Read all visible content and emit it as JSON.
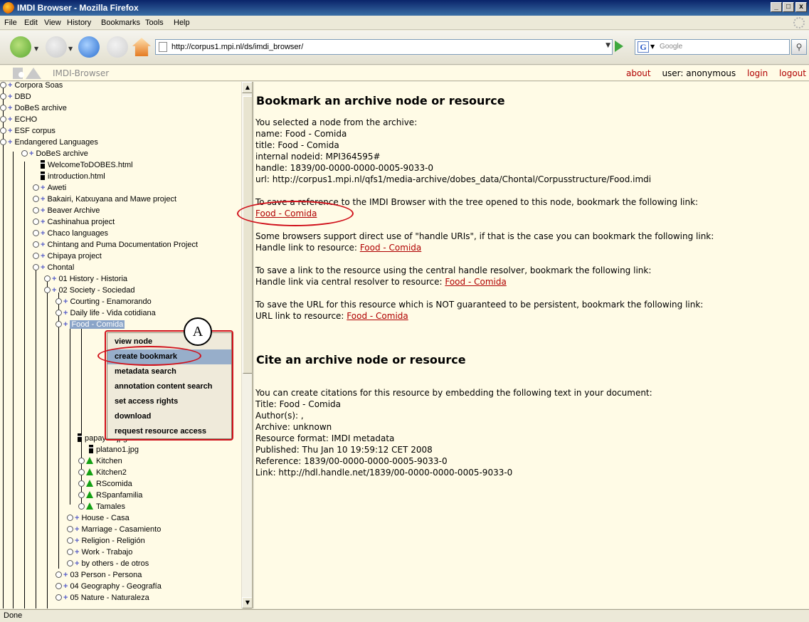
{
  "window": {
    "title": "IMDI Browser - Mozilla Firefox",
    "minimize": "_",
    "maximize": "□",
    "close": "x"
  },
  "menubar": [
    "File",
    "Edit",
    "View",
    "History",
    "Bookmarks",
    "Tools",
    "Help"
  ],
  "navbar": {
    "url": "http://corpus1.mpi.nl/ds/imdi_browser/",
    "search_placeholder": "Google",
    "search_engine_icon": "G"
  },
  "app": {
    "title": "IMDI-Browser",
    "links": {
      "about": "about",
      "user": "user: anonymous",
      "login": "login",
      "logout": "logout"
    }
  },
  "tree": [
    {
      "label": "Corpora Soas"
    },
    {
      "label": "DBD"
    },
    {
      "label": "DoBeS archive"
    },
    {
      "label": "ECHO"
    },
    {
      "label": "ESF corpus"
    },
    {
      "label": "Endangered Languages"
    },
    {
      "label": "DoBeS archive"
    },
    {
      "label": "WelcomeToDOBES.html"
    },
    {
      "label": "introduction.html"
    },
    {
      "label": "Aweti"
    },
    {
      "label": "Bakairi, Katxuyana and Mawe project"
    },
    {
      "label": "Beaver Archive"
    },
    {
      "label": "Cashinahua project"
    },
    {
      "label": "Chaco languages"
    },
    {
      "label": "Chintang and Puma Documentation Project"
    },
    {
      "label": "Chipaya project"
    },
    {
      "label": "Chontal"
    },
    {
      "label": "01 History - Historia"
    },
    {
      "label": "02 Society - Sociedad"
    },
    {
      "label": "Courting - Enamorando"
    },
    {
      "label": "Daily life - Vida cotidiana"
    },
    {
      "label": "Food - Comida"
    },
    {
      "label": "papaya2.jpg"
    },
    {
      "label": "platano1.jpg"
    },
    {
      "label": "Kitchen"
    },
    {
      "label": "Kitchen2"
    },
    {
      "label": "RScomida"
    },
    {
      "label": "RSpanfamilia"
    },
    {
      "label": "Tamales"
    },
    {
      "label": "House - Casa"
    },
    {
      "label": "Marriage - Casamiento"
    },
    {
      "label": "Religion - Religión"
    },
    {
      "label": "Work - Trabajo"
    },
    {
      "label": "by others - de otros"
    },
    {
      "label": "03 Person - Persona"
    },
    {
      "label": "04 Geography - Geografía"
    },
    {
      "label": "05 Nature - Naturaleza"
    }
  ],
  "context_menu": {
    "items": [
      "view node",
      "create bookmark",
      "metadata search",
      "annotation content search",
      "set access rights",
      "download",
      "request resource access"
    ],
    "highlighted": "create bookmark"
  },
  "callout": "A",
  "bookmark": {
    "heading": "Bookmark an archive node or resource",
    "intro": "You selected a node from the archive:",
    "name": "name: Food - Comida",
    "title": "title: Food - Comida",
    "nodeid": "internal nodeid: MPI364595#",
    "handle": "handle: 1839/00-0000-0000-0005-9033-0",
    "url": "url: http://corpus1.mpi.nl/qfs1/media-archive/dobes_data/Chontal/Corpusstructure/Food.imdi",
    "save_text": "To save a reference to the IMDI Browser with the tree opened to this node, bookmark the following link:",
    "save_link": "Food - Comida",
    "handle_uri_text": "Some browsers support direct use of \"handle URIs\", if that is the case you can bookmark the following link:",
    "handle_uri_prefix": "Handle link to resource:",
    "handle_uri_link": "Food - Comida",
    "resolver_text": "To save a link to the resource using the central handle resolver, bookmark the following link:",
    "resolver_prefix": "Handle link via central resolver to resource:",
    "resolver_link": "Food - Comida",
    "url_text": "To save the URL for this resource which is NOT guaranteed to be persistent, bookmark the following link:",
    "url_prefix": "URL link to resource:",
    "url_link": "Food - Comida"
  },
  "cite": {
    "heading": "Cite an archive node or resource",
    "intro": "You can create citations for this resource by embedding the following text in your document:",
    "title": "Title: Food - Comida",
    "authors": "Author(s): ,",
    "archive": "Archive: unknown",
    "format": "Resource format: IMDI metadata",
    "published": "Published: Thu Jan 10 19:59:12 CET 2008",
    "reference": "Reference: 1839/00-0000-0000-0005-9033-0",
    "link": "Link: http://hdl.handle.net/1839/00-0000-0000-0005-9033-0"
  },
  "status": "Done",
  "colors": {
    "link": "#b00000",
    "annotation": "#d0101a",
    "selection": "#97aeca"
  }
}
